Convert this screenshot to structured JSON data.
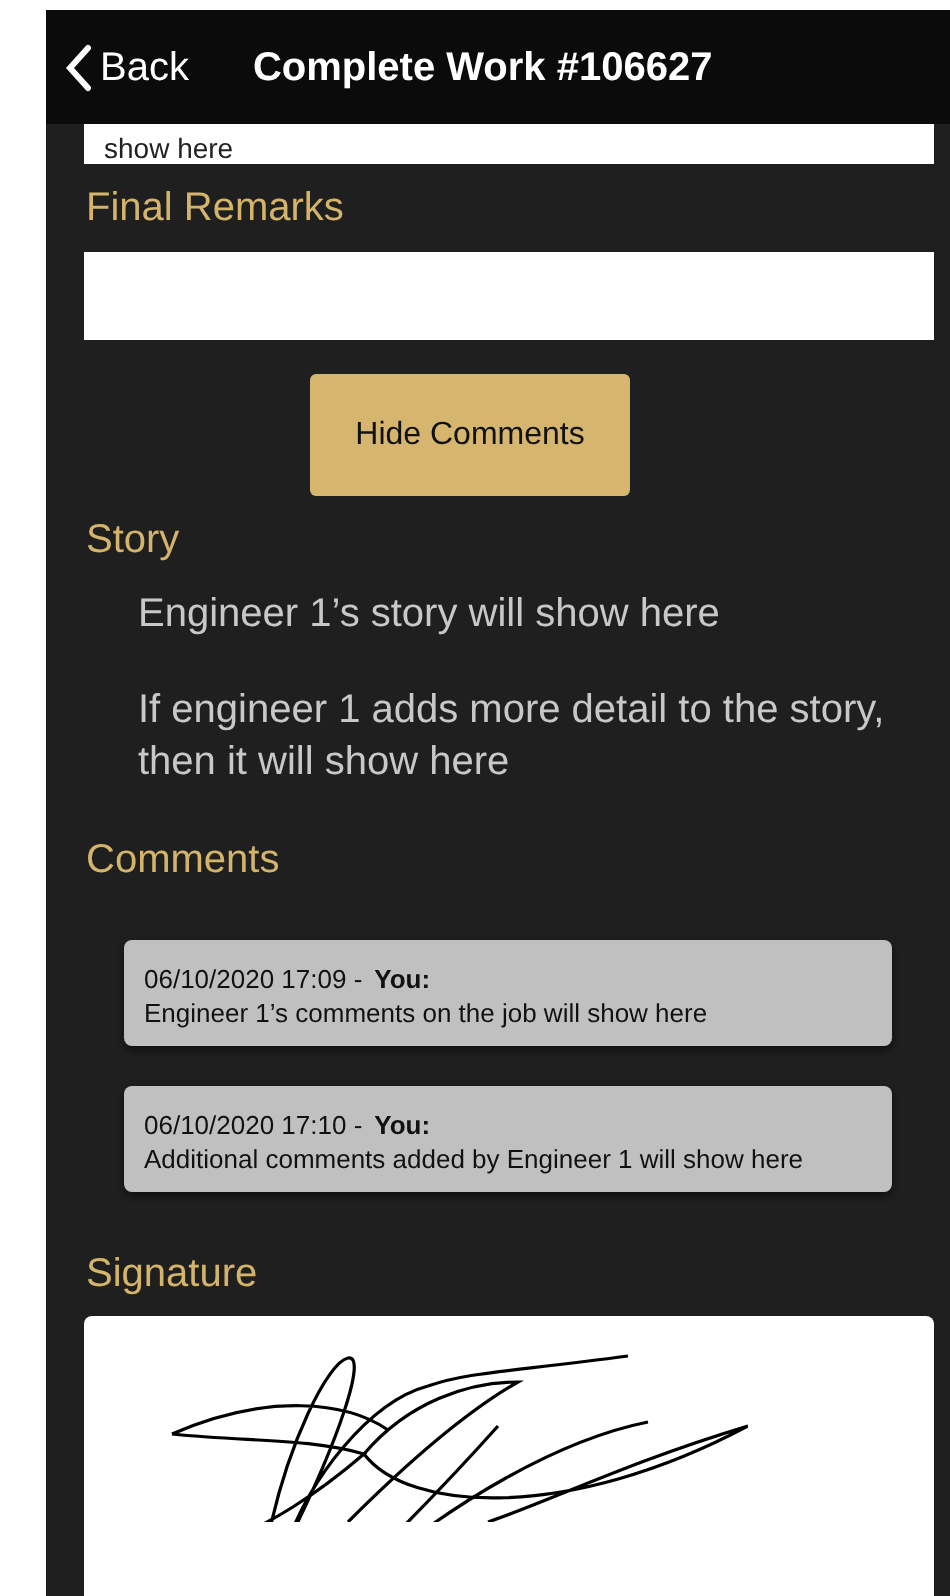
{
  "header": {
    "back": "Back",
    "title": "Complete Work #106627"
  },
  "cut_field": {
    "value": "show here"
  },
  "final_remarks": {
    "label": "Final Remarks"
  },
  "toggle_button": "Hide Comments",
  "story": {
    "label": "Story",
    "paragraphs": [
      "Engineer 1’s story will show here",
      "If engineer 1 adds more detail to the story, then it will show here"
    ]
  },
  "comments": {
    "label": "Comments",
    "items": [
      {
        "timestamp": "06/10/2020 17:09 -",
        "author": "You:",
        "text": "Engineer 1’s comments on the job will show here"
      },
      {
        "timestamp": "06/10/2020 17:10 -",
        "author": "You:",
        "text": "Additional comments added by Engineer 1 will show here"
      }
    ]
  },
  "signature": {
    "label": "Signature"
  }
}
